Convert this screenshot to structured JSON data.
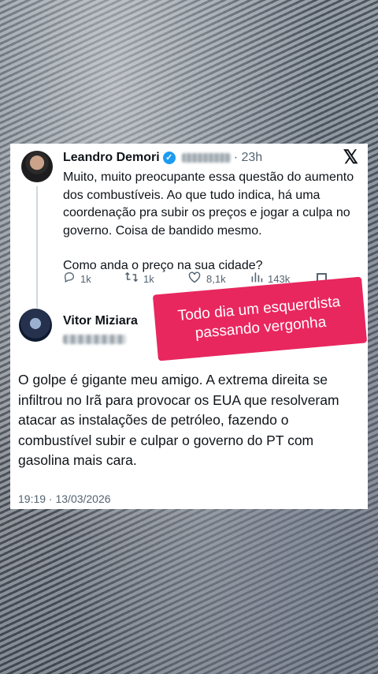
{
  "quoted_tweet": {
    "author_name": "Leandro Demori",
    "verified_glyph": "✓",
    "time_ago": "· 23h",
    "x_logo": "𝕏",
    "text_1": "Muito, muito preocupante essa questão do aumento dos combustíveis. Ao que tudo indica, há uma coordenação pra subir os preços e jogar a culpa no governo. Coisa de bandido mesmo.",
    "text_2": "Como anda o preço na sua cidade?",
    "actions": {
      "reply_icon": "reply-icon",
      "reply_count": "1k",
      "retweet_icon": "retweet-icon",
      "retweet_count": "1k",
      "like_icon": "heart-icon",
      "like_count": "8,1k",
      "views_icon": "views-icon",
      "views_count": "143k",
      "bookmark_icon": "bookmark-icon"
    }
  },
  "reply_tweet": {
    "author_name": "Vitor Miziara",
    "text": "O golpe é gigante meu amigo. A extrema direita se infiltrou no Irã para provocar os EUA que resolveram atacar as instalações de petróleo, fazendo o combustível subir e culpar o governo do PT com gasolina mais cara.",
    "timestamp": "19:19 · 13/03/2026"
  },
  "sticker": {
    "line_1": "Todo dia um esquerdista",
    "line_2": "passando vergonha"
  },
  "colors": {
    "sticker_bg": "#e8275f",
    "verified_blue": "#1d9bf0",
    "secondary_text": "#536471"
  }
}
